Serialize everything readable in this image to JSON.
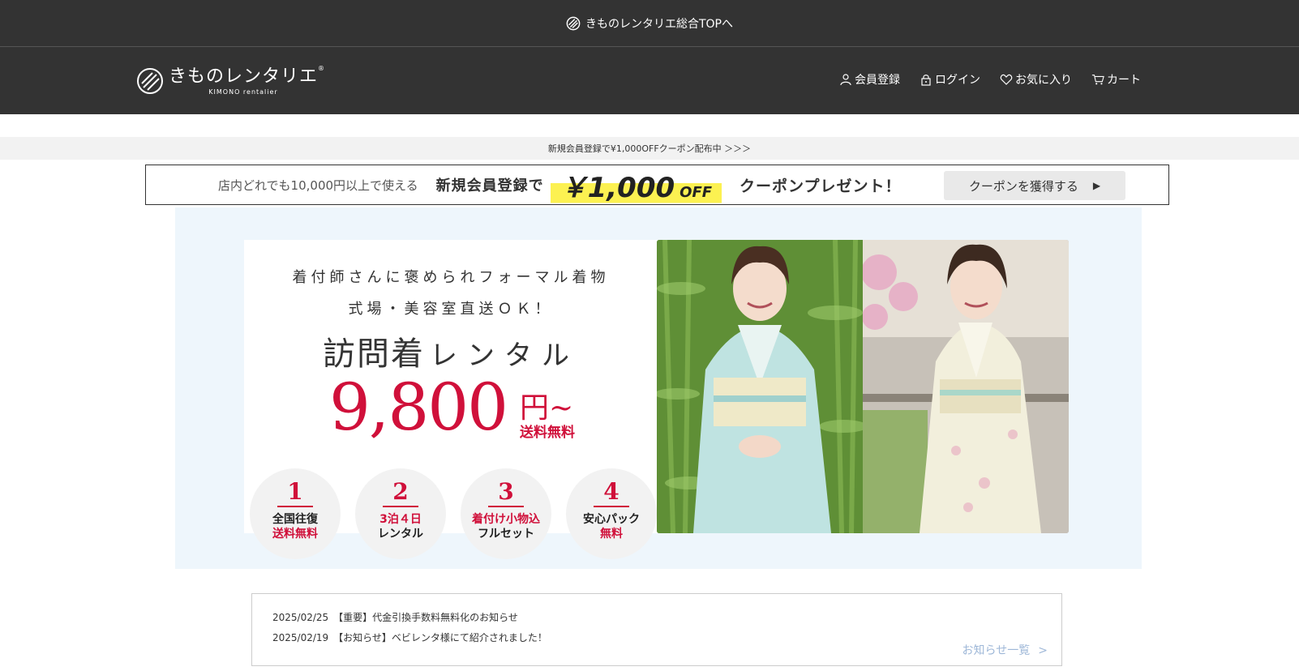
{
  "topbar": {
    "label": "きものレンタリエ総合TOPへ"
  },
  "brand": {
    "name_jp": "きものレンタリエ",
    "name_en": "KIMONO rentalier",
    "reg": "®"
  },
  "nav": {
    "items": [
      {
        "label": "会員登録",
        "icon": "person-icon"
      },
      {
        "label": "ログイン",
        "icon": "lock-icon"
      },
      {
        "label": "お気に入り",
        "icon": "heart-icon"
      },
      {
        "label": "カート",
        "icon": "cart-icon"
      }
    ]
  },
  "promo_strip": {
    "text": "新規会員登録で¥1,000OFFクーポン配布中 ＞＞＞"
  },
  "coupon": {
    "lead": "店内どれでも10,000円以上で使える",
    "main": "新規会員登録で",
    "amount": "￥1,000",
    "off": "OFF",
    "present": "クーポンプレゼント！",
    "cta": "クーポンを獲得する",
    "cta_arrow": "▶"
  },
  "hero": {
    "line1": "着付師さんに褒められフォーマル着物",
    "line2": "式場・美容室直送ＯＫ！",
    "title_main": "訪問着",
    "title_sub": "レンタル",
    "price": "9,800",
    "price_unit": "円~",
    "price_note": "送料無料",
    "features": [
      {
        "num": "1",
        "l1": "全国往復",
        "l2": "送料無料"
      },
      {
        "num": "2",
        "l1": "3泊４日",
        "l2": "レンタル"
      },
      {
        "num": "3",
        "l1": "着付け小物込",
        "l2": "フルセット"
      },
      {
        "num": "4",
        "l1": "安心パック",
        "l2": "無料"
      }
    ]
  },
  "news": {
    "items": [
      {
        "date": "2025/02/25",
        "text": "【重要】代金引換手数料無料化のお知らせ"
      },
      {
        "date": "2025/02/19",
        "text": "【お知らせ】ベビレンタ様にて紹介されました！"
      }
    ],
    "more": "お知らせ一覧",
    "more_chev": ">"
  },
  "colors": {
    "header_bg": "#333333",
    "accent_red": "#d0103a",
    "highlight_yellow": "#fcf151",
    "hero_bg": "#eef6fc"
  }
}
